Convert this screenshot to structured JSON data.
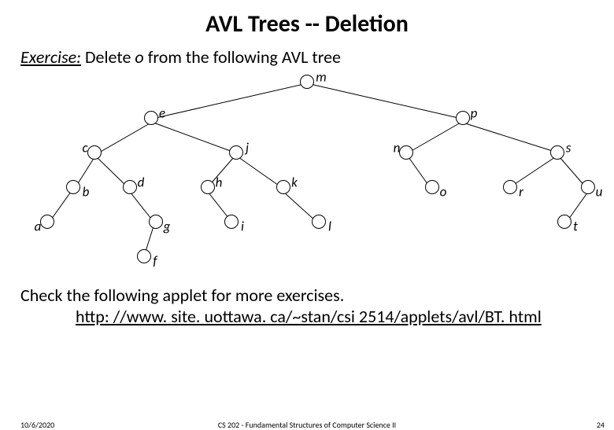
{
  "title": "AVL Trees -- Deletion",
  "exercise": {
    "label": "Exercise:",
    "pre": " Delete ",
    "target": "o",
    "post": " from the following AVL tree"
  },
  "nodes": {
    "m": "m",
    "e": "e",
    "p": "p",
    "c": "c",
    "j": "j",
    "n": "n",
    "s": "s",
    "b": "b",
    "d": "d",
    "h": "h",
    "k": "k",
    "o": "o",
    "r": "r",
    "u": "u",
    "a": "a",
    "g": "g",
    "i": "i",
    "l": "l",
    "t": "t",
    "f": "f"
  },
  "checkText": "Check the following applet for more exercises.",
  "linkText": "http: //www. site. uottawa. ca/~stan/csi 2514/applets/avl/BT. html",
  "footer": {
    "date": "10/6/2020",
    "course": "CS 202 - Fundamental Structures of Computer Science II",
    "page": "24"
  },
  "chart_data": {
    "type": "tree",
    "title": "AVL tree before deleting o",
    "root": "m",
    "edges": [
      [
        "m",
        "e"
      ],
      [
        "m",
        "p"
      ],
      [
        "e",
        "c"
      ],
      [
        "e",
        "j"
      ],
      [
        "p",
        "n"
      ],
      [
        "p",
        "s"
      ],
      [
        "c",
        "b"
      ],
      [
        "c",
        "d"
      ],
      [
        "j",
        "h"
      ],
      [
        "j",
        "k"
      ],
      [
        "n",
        "o"
      ],
      [
        "s",
        "r"
      ],
      [
        "s",
        "u"
      ],
      [
        "b",
        "a"
      ],
      [
        "d",
        "g"
      ],
      [
        "h",
        "i"
      ],
      [
        "k",
        "l"
      ],
      [
        "u",
        "t"
      ],
      [
        "g",
        "f"
      ]
    ]
  }
}
